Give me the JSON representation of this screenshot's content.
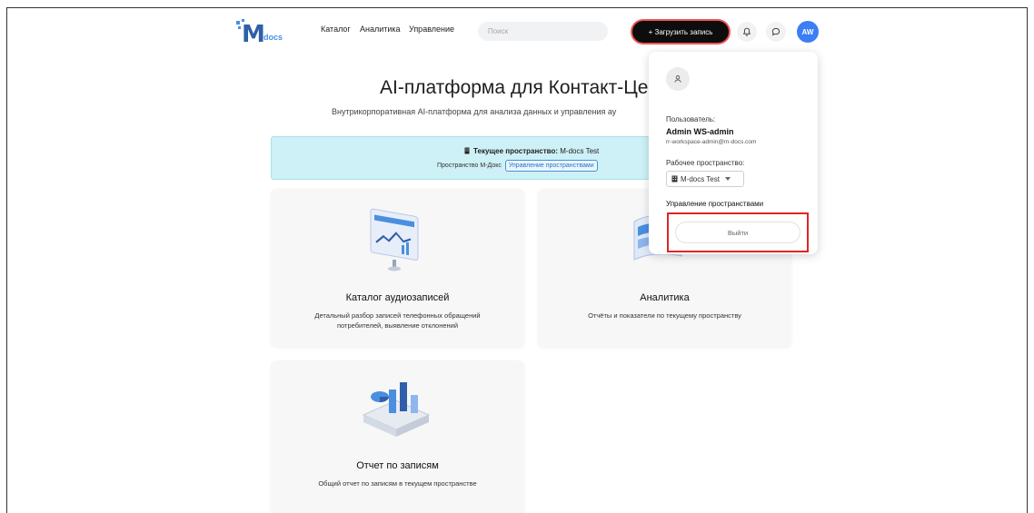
{
  "brand": {
    "logo_text": "M",
    "logo_suffix": "docs"
  },
  "nav": {
    "items": [
      {
        "label": "Каталог"
      },
      {
        "label": "Аналитика"
      },
      {
        "label": "Управление"
      }
    ]
  },
  "search": {
    "placeholder": "Поиск"
  },
  "header_actions": {
    "upload_label": "+ Загрузить запись",
    "avatar_initials": "AW"
  },
  "hero": {
    "title": "AI-платформа для Контакт-Цен",
    "subtitle": "Внутрикорпоративная AI-платформа для анализа данных и управления ау"
  },
  "space_banner": {
    "label": "Текущее пространство:",
    "value": "M-docs Test",
    "space_type": "Пространство М-Докс",
    "manage_link": "Управление пространствами"
  },
  "cards": [
    {
      "title": "Каталог аудиозаписей",
      "description_line1": "Детальный разбор записей телефонных обращений",
      "description_line2": "потребителей, выявление отклонений"
    },
    {
      "title": "Аналитика",
      "description_line1": "Отчёты и показатели по текущему пространству",
      "description_line2": ""
    },
    {
      "title": "Отчет по записям",
      "description_line1": "Общий отчет по записям в текущем пространстве",
      "description_line2": ""
    }
  ],
  "user_menu": {
    "user_label": "Пользователь:",
    "user_name": "Admin WS-admin",
    "user_email": "rr-workspace-admin@m-docs.com",
    "workspace_label": "Рабочее пространство:",
    "workspace_value": "M-docs Test",
    "manage_spaces": "Управление пространствами",
    "logout_label": "Выйти"
  },
  "colors": {
    "accent": "#3d7df5",
    "banner_bg": "#cdf1f6",
    "highlight_border": "#e02424",
    "upload_bg": "#0d0d0d"
  }
}
